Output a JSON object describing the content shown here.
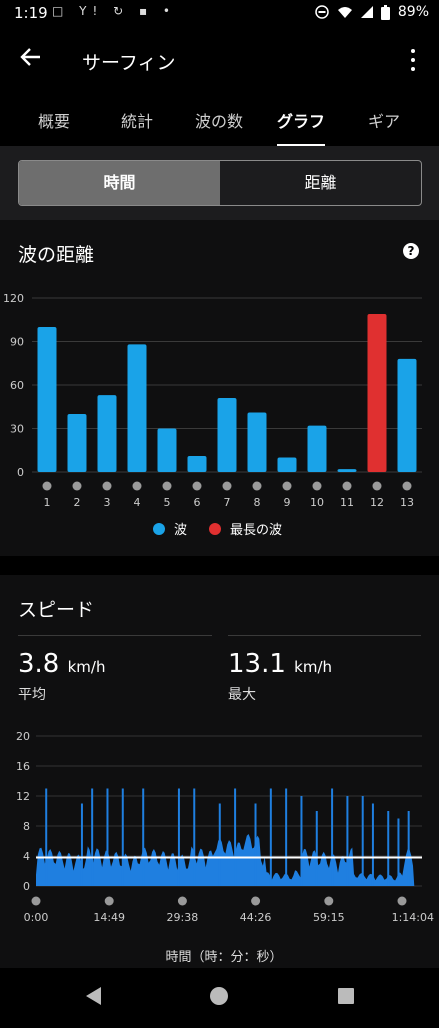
{
  "status_bar": {
    "time": "1:19",
    "left_icons": "□ Y! ↻ ▪ •",
    "battery": "89%"
  },
  "app_bar": {
    "title": "サーフィン"
  },
  "tabs": [
    "概要",
    "統計",
    "波の数",
    "グラフ",
    "ギア"
  ],
  "active_tab": "グラフ",
  "segment": {
    "time_label": "時間",
    "distance_label": "距離",
    "selected": "時間"
  },
  "wave_distance": {
    "title": "波の距離",
    "help": "?",
    "chart_data": {
      "type": "bar",
      "categories": [
        "1",
        "2",
        "3",
        "4",
        "5",
        "6",
        "7",
        "8",
        "9",
        "10",
        "11",
        "12",
        "13"
      ],
      "values": [
        100,
        40,
        53,
        88,
        30,
        11,
        51,
        41,
        10,
        32,
        2,
        109,
        78
      ],
      "highlight_index": 11,
      "ylim": [
        0,
        120
      ],
      "yticks": [
        "0",
        "30",
        "60",
        "90",
        "120"
      ],
      "grid": true,
      "colors": {
        "wave": "#1aa3e8",
        "longest": "#e03030"
      },
      "legend": {
        "wave": "波",
        "longest": "最長の波"
      },
      "legend_position": "bottom"
    }
  },
  "speed": {
    "title": "スピード",
    "avg_value": "3.8",
    "avg_unit": "km/h",
    "avg_label": "平均",
    "max_value": "13.1",
    "max_unit": "km/h",
    "max_label": "最大",
    "chart_data": {
      "type": "area",
      "ylim": [
        0,
        20
      ],
      "yticks": [
        "0",
        "4",
        "8",
        "12",
        "16",
        "20"
      ],
      "xticks": [
        "0:00",
        "14:49",
        "29:38",
        "44:26",
        "59:15",
        "1:14:04"
      ],
      "xlabel": "時間（時：分：秒）",
      "average_line": 3.8,
      "color": "#1f7fe0",
      "grid": true,
      "spikes": [
        [
          2,
          13
        ],
        [
          9,
          11
        ],
        [
          11,
          13
        ],
        [
          14,
          13
        ],
        [
          17,
          13
        ],
        [
          21,
          13
        ],
        [
          28,
          13
        ],
        [
          31,
          13
        ],
        [
          36,
          11
        ],
        [
          39,
          13
        ],
        [
          43,
          11
        ],
        [
          46,
          13
        ],
        [
          49,
          13
        ],
        [
          52,
          12
        ],
        [
          55,
          10
        ],
        [
          58,
          13
        ],
        [
          61,
          12
        ],
        [
          64,
          12
        ],
        [
          66,
          11
        ],
        [
          69,
          10
        ],
        [
          71,
          9
        ],
        [
          73,
          10
        ]
      ]
    }
  },
  "nav": {
    "back": "◀",
    "home": "●",
    "recents": "■"
  }
}
